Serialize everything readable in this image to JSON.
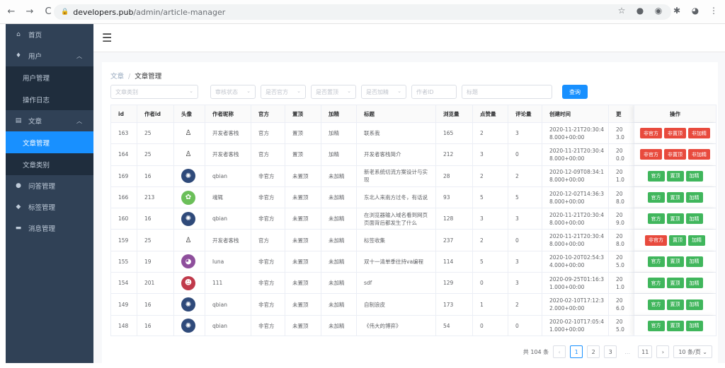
{
  "browser": {
    "back": "←",
    "forward": "→",
    "reload": "C",
    "url_host": "developers.pub",
    "url_path": "/admin/article-manager"
  },
  "sidebar": {
    "items": [
      {
        "label": "首页",
        "icon": "home-icon"
      },
      {
        "label": "用户",
        "icon": "user-icon"
      },
      {
        "label": "用户管理",
        "icon": ""
      },
      {
        "label": "操作日志",
        "icon": ""
      },
      {
        "label": "文章",
        "icon": "document-icon"
      },
      {
        "label": "文章管理",
        "icon": ""
      },
      {
        "label": "文章类别",
        "icon": ""
      },
      {
        "label": "问答管理",
        "icon": "question-icon"
      },
      {
        "label": "标签管理",
        "icon": "tag-icon"
      },
      {
        "label": "消息管理",
        "icon": "message-icon"
      }
    ]
  },
  "breadcrumb": {
    "root": "文章",
    "current": "文章管理"
  },
  "filters": {
    "category": "文章类别",
    "review": "审核状态",
    "official": "是否官方",
    "top": "是否置顶",
    "featured": "是否加精",
    "author_id": "作者ID",
    "title": "标题",
    "query_button": "查询"
  },
  "table": {
    "headers": [
      "id",
      "作者id",
      "头像",
      "作者昵称",
      "官方",
      "置顶",
      "加精",
      "标题",
      "浏览量",
      "点赞量",
      "评论量",
      "创建时间",
      "更",
      "操作"
    ],
    "rows": [
      {
        "id": "163",
        "author_id": "25",
        "avatar": "sketch",
        "nick": "开发者客栈",
        "official": "官方",
        "top": "置顶",
        "featured": "加精",
        "title": "联系我",
        "views": "165",
        "likes": "2",
        "comments": "3",
        "created1": "2020-11-21T20:30:4",
        "created2": "8.000+00:00",
        "upd1": "20",
        "upd2": "3.0",
        "ops": [
          "非官方",
          "非置顶",
          "非加精"
        ],
        "op_colors": [
          "red",
          "red",
          "red"
        ]
      },
      {
        "id": "164",
        "author_id": "25",
        "avatar": "sketch",
        "nick": "开发者客栈",
        "official": "官方",
        "top": "置顶",
        "featured": "加精",
        "title": "开发者客栈简介",
        "views": "212",
        "likes": "3",
        "comments": "0",
        "created1": "2020-11-21T20:30:4",
        "created2": "8.000+00:00",
        "upd1": "20",
        "upd2": "0.0",
        "ops": [
          "非官方",
          "非置顶",
          "非加精"
        ],
        "op_colors": [
          "red",
          "red",
          "red"
        ]
      },
      {
        "id": "169",
        "author_id": "16",
        "avatar": "badge",
        "nick": "qbian",
        "official": "非官方",
        "top": "未置顶",
        "featured": "未加精",
        "title": "新老系统切流方案设计与实现",
        "views": "28",
        "likes": "2",
        "comments": "2",
        "created1": "2020-12-09T08:34:1",
        "created2": "8.000+00:00",
        "upd1": "20",
        "upd2": "1.0",
        "ops": [
          "官方",
          "置顶",
          "加精"
        ],
        "op_colors": [
          "green",
          "green",
          "green"
        ]
      },
      {
        "id": "166",
        "author_id": "213",
        "avatar": "pixel",
        "nick": "魂辄",
        "official": "非官方",
        "top": "未置顶",
        "featured": "未加精",
        "title": "东北人来南方过冬，有话说",
        "views": "93",
        "likes": "5",
        "comments": "5",
        "created1": "2020-12-02T14:36:3",
        "created2": "8.000+00:00",
        "upd1": "20",
        "upd2": "8.0",
        "ops": [
          "官方",
          "置顶",
          "加精"
        ],
        "op_colors": [
          "green",
          "green",
          "green"
        ]
      },
      {
        "id": "160",
        "author_id": "16",
        "avatar": "badge",
        "nick": "qbian",
        "official": "非官方",
        "top": "未置顶",
        "featured": "未加精",
        "title": "在浏览器输入域名看到网页页面背后都发生了什么",
        "views": "128",
        "likes": "3",
        "comments": "3",
        "created1": "2020-11-21T20:30:4",
        "created2": "8.000+00:00",
        "upd1": "20",
        "upd2": "9.0",
        "ops": [
          "官方",
          "置顶",
          "加精"
        ],
        "op_colors": [
          "green",
          "green",
          "green"
        ]
      },
      {
        "id": "159",
        "author_id": "25",
        "avatar": "sketch",
        "nick": "开发者客栈",
        "official": "官方",
        "top": "未置顶",
        "featured": "未加精",
        "title": "标签收集",
        "views": "237",
        "likes": "2",
        "comments": "0",
        "created1": "2020-11-21T20:30:4",
        "created2": "8.000+00:00",
        "upd1": "20",
        "upd2": "8.0",
        "ops": [
          "非官方",
          "置顶",
          "加精"
        ],
        "op_colors": [
          "red",
          "green",
          "green"
        ]
      },
      {
        "id": "155",
        "author_id": "19",
        "avatar": "purple",
        "nick": "luna",
        "official": "非官方",
        "top": "未置顶",
        "featured": "未加精",
        "title": "双十一清单季往持va编程",
        "views": "114",
        "likes": "5",
        "comments": "3",
        "created1": "2020-10-20T02:54:3",
        "created2": "4.000+00:00",
        "upd1": "20",
        "upd2": "5.0",
        "ops": [
          "官方",
          "置顶",
          "加精"
        ],
        "op_colors": [
          "green",
          "green",
          "green"
        ]
      },
      {
        "id": "154",
        "author_id": "201",
        "avatar": "red",
        "nick": "111",
        "official": "非官方",
        "top": "未置顶",
        "featured": "未加精",
        "title": "sdf",
        "views": "129",
        "likes": "0",
        "comments": "3",
        "created1": "2020-09-25T01:16:3",
        "created2": "1.000+00:00",
        "upd1": "20",
        "upd2": "1.0",
        "ops": [
          "官方",
          "置顶",
          "加精"
        ],
        "op_colors": [
          "green",
          "green",
          "green"
        ]
      },
      {
        "id": "149",
        "author_id": "16",
        "avatar": "badge",
        "nick": "qbian",
        "official": "非官方",
        "top": "未置顶",
        "featured": "未加精",
        "title": "自制浪皮",
        "views": "173",
        "likes": "1",
        "comments": "2",
        "created1": "2020-02-10T17:12:3",
        "created2": "2.000+00:00",
        "upd1": "20",
        "upd2": "6.0",
        "ops": [
          "官方",
          "置顶",
          "加精"
        ],
        "op_colors": [
          "green",
          "green",
          "green"
        ]
      },
      {
        "id": "148",
        "author_id": "16",
        "avatar": "badge",
        "nick": "qbian",
        "official": "非官方",
        "top": "未置顶",
        "featured": "未加精",
        "title": "《伟大的博弈》",
        "views": "54",
        "likes": "0",
        "comments": "0",
        "created1": "2020-02-10T17:05:4",
        "created2": "1.000+00:00",
        "upd1": "20",
        "upd2": "5.0",
        "ops": [
          "官方",
          "置顶",
          "加精"
        ],
        "op_colors": [
          "green",
          "green",
          "green"
        ]
      }
    ]
  },
  "pagination": {
    "total": "共 104 条",
    "pages": [
      "1",
      "2",
      "3",
      "…",
      "11"
    ],
    "page_size": "10 条/页",
    "prev": "‹",
    "next": "›",
    "active_page": "1"
  },
  "colors": {
    "sidebar": "#304156",
    "accent": "#1890ff",
    "danger": "#e84a3d",
    "success": "#40b65c"
  }
}
